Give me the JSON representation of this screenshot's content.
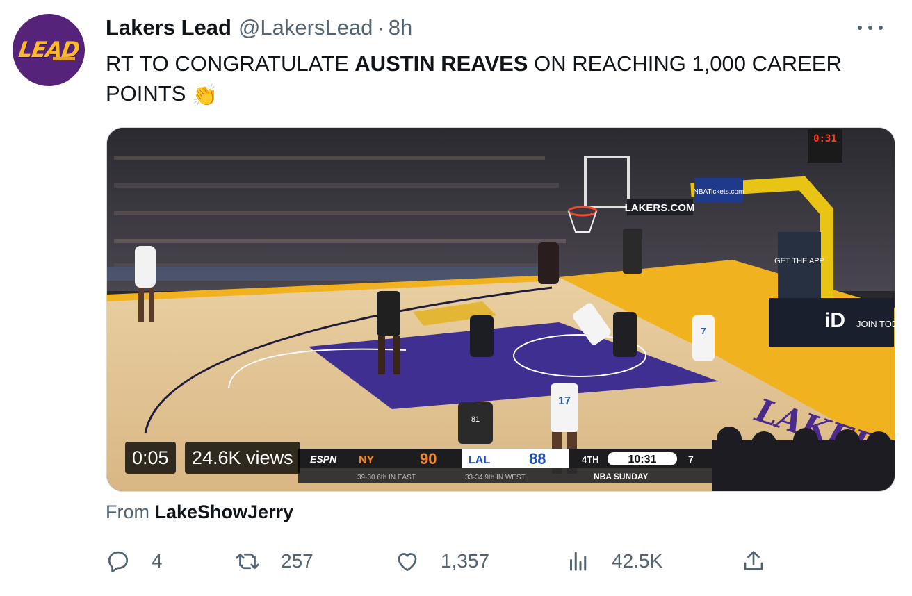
{
  "author": {
    "display_name": "Lakers Lead",
    "handle": "@LakersLead",
    "separator": "·",
    "time": "8h",
    "avatar_text": "LEAD"
  },
  "tweet": {
    "text_before": "RT TO CONGRATULATE ",
    "text_bold": "AUSTIN REAVES",
    "text_after": " ON REACHING 1,000 CAREER POINTS ",
    "emoji": "👏"
  },
  "video": {
    "elapsed": "0:05",
    "views": "24.6K views",
    "scorebug": {
      "network": "ESPN",
      "away_team": "NY",
      "away_score": "90",
      "away_record": "39-30 6th IN EAST",
      "home_team": "LAL",
      "home_score": "88",
      "home_record": "33-34 9th IN WEST",
      "quarter": "4TH",
      "clock": "10:31",
      "shot_clock": "7",
      "footer": "NBA SUNDAY"
    },
    "arena_signs": {
      "baseline": "LAKERS.COM",
      "app": "GET THE APP",
      "nba_id": "JOIN TODAY",
      "game_clock": "0:31"
    },
    "jersey_numbers": [
      "17",
      "7",
      "81"
    ]
  },
  "source": {
    "prefix": "From ",
    "name": "LakeShowJerry"
  },
  "actions": {
    "replies": "4",
    "retweets": "257",
    "likes": "1,357",
    "views": "42.5K"
  },
  "icons": {
    "more": "more-icon",
    "reply": "reply-icon",
    "retweet": "retweet-icon",
    "like": "heart-icon",
    "views": "views-icon",
    "share": "share-icon"
  },
  "colors": {
    "avatar_bg": "#55247a",
    "lakers_gold": "#fdb927",
    "lakers_purple": "#552583",
    "knicks_orange": "#f58426",
    "secondary_text": "#536471"
  }
}
